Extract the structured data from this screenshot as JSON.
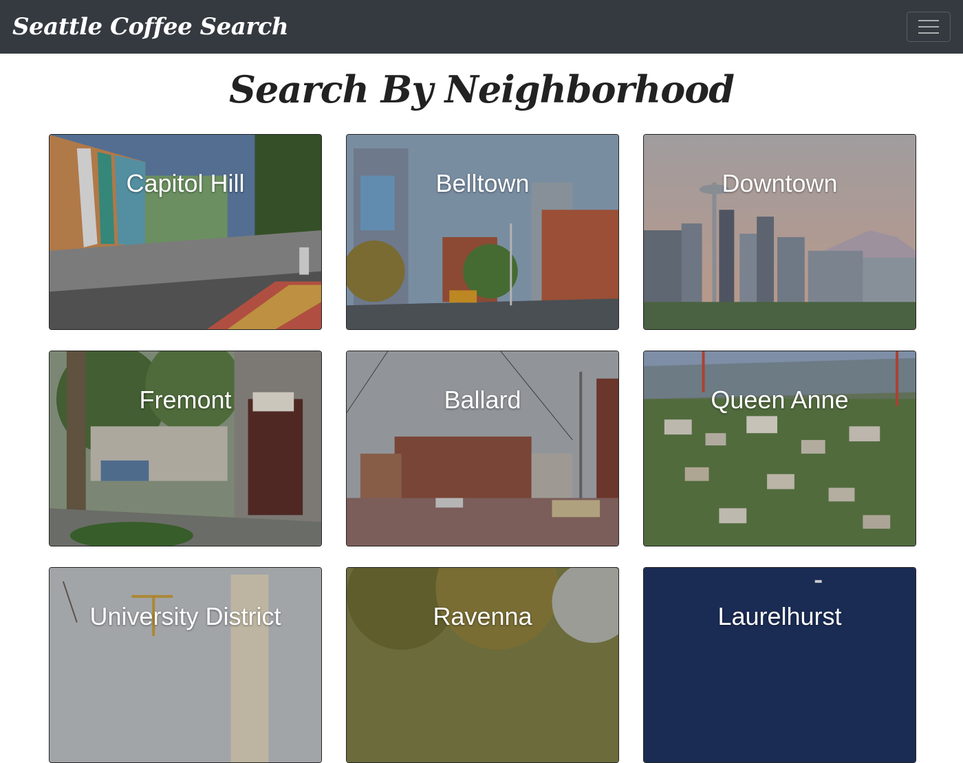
{
  "navbar": {
    "brand": "Seattle Coffee Search",
    "menu_icon": "hamburger-menu-icon"
  },
  "page": {
    "title": "Search By Neighborhood"
  },
  "neighborhoods": [
    {
      "name": "Capitol Hill"
    },
    {
      "name": "Belltown"
    },
    {
      "name": "Downtown"
    },
    {
      "name": "Fremont"
    },
    {
      "name": "Ballard"
    },
    {
      "name": "Queen Anne"
    },
    {
      "name": "University District"
    },
    {
      "name": "Ravenna"
    },
    {
      "name": "Laurelhurst"
    }
  ],
  "colors": {
    "navbar_bg": "#343a40",
    "card_label": "#ffffff"
  }
}
